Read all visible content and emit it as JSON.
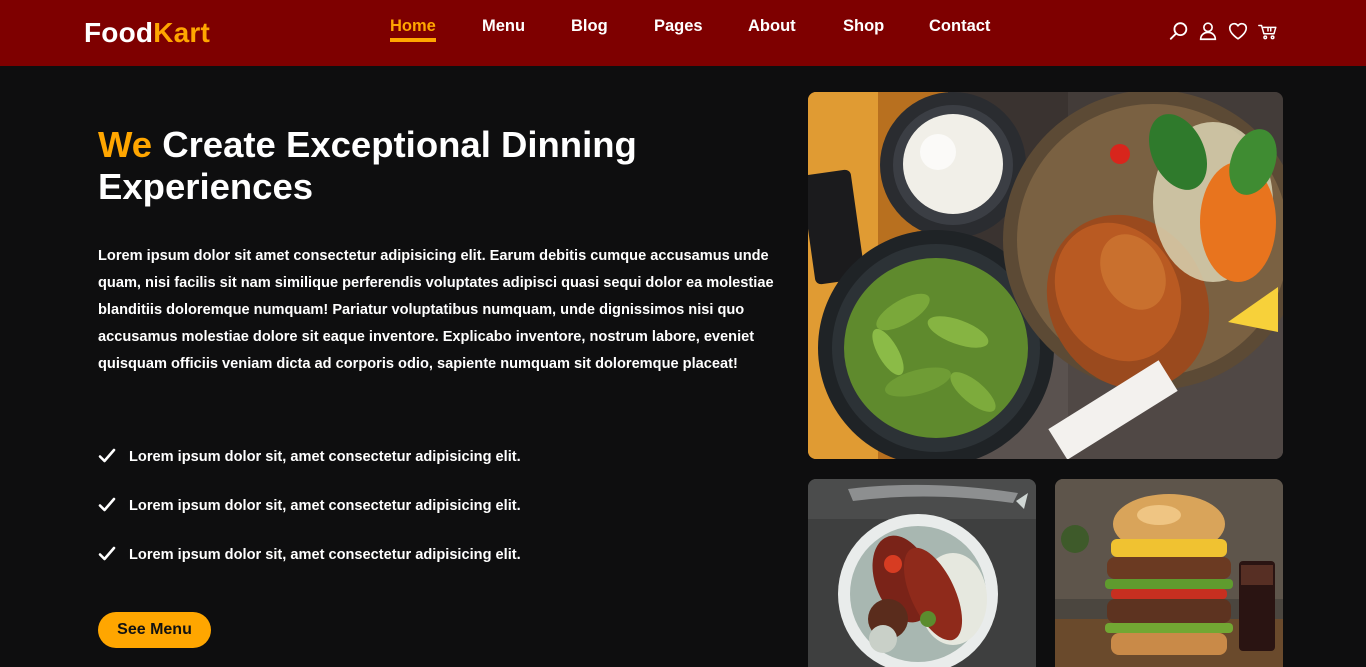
{
  "header": {
    "logo_part1": "Food",
    "logo_part2": "Kart",
    "nav": [
      {
        "label": "Home",
        "active": true
      },
      {
        "label": "Menu"
      },
      {
        "label": "Blog"
      },
      {
        "label": "Pages"
      },
      {
        "label": "About"
      },
      {
        "label": "Shop"
      },
      {
        "label": "Contact"
      }
    ],
    "icons": [
      "search-icon",
      "user-icon",
      "heart-icon",
      "cart-icon"
    ]
  },
  "hero": {
    "headline_accent": "We",
    "headline_rest": " Create Exceptional Dinning Experiences",
    "intro": "Lorem ipsum dolor sit amet consectetur adipisicing elit. Earum debitis cumque accusamus unde quam, nisi facilis sit nam similique perferendis voluptates adipisci quasi sequi dolor ea molestiae blanditiis doloremque numquam! Pariatur voluptatibus numquam, unde dignissimos nisi quo accusamus molestiae dolore sit eaque inventore. Explicabo inventore, nostrum labore, eveniet quisquam officiis veniam dicta ad corporis odio, sapiente numquam sit doloremque placeat!",
    "features": [
      "Lorem ipsum dolor sit, amet consectetur adipisicing elit.",
      "Lorem ipsum dolor sit, amet consectetur adipisicing elit.",
      "Lorem ipsum dolor sit, amet consectetur adipisicing elit."
    ],
    "cta_label": "See Menu"
  },
  "colors": {
    "header_bg": "#7e0000",
    "accent": "#ffa600",
    "page_bg": "#0e0e0f",
    "text": "#ffffff"
  }
}
